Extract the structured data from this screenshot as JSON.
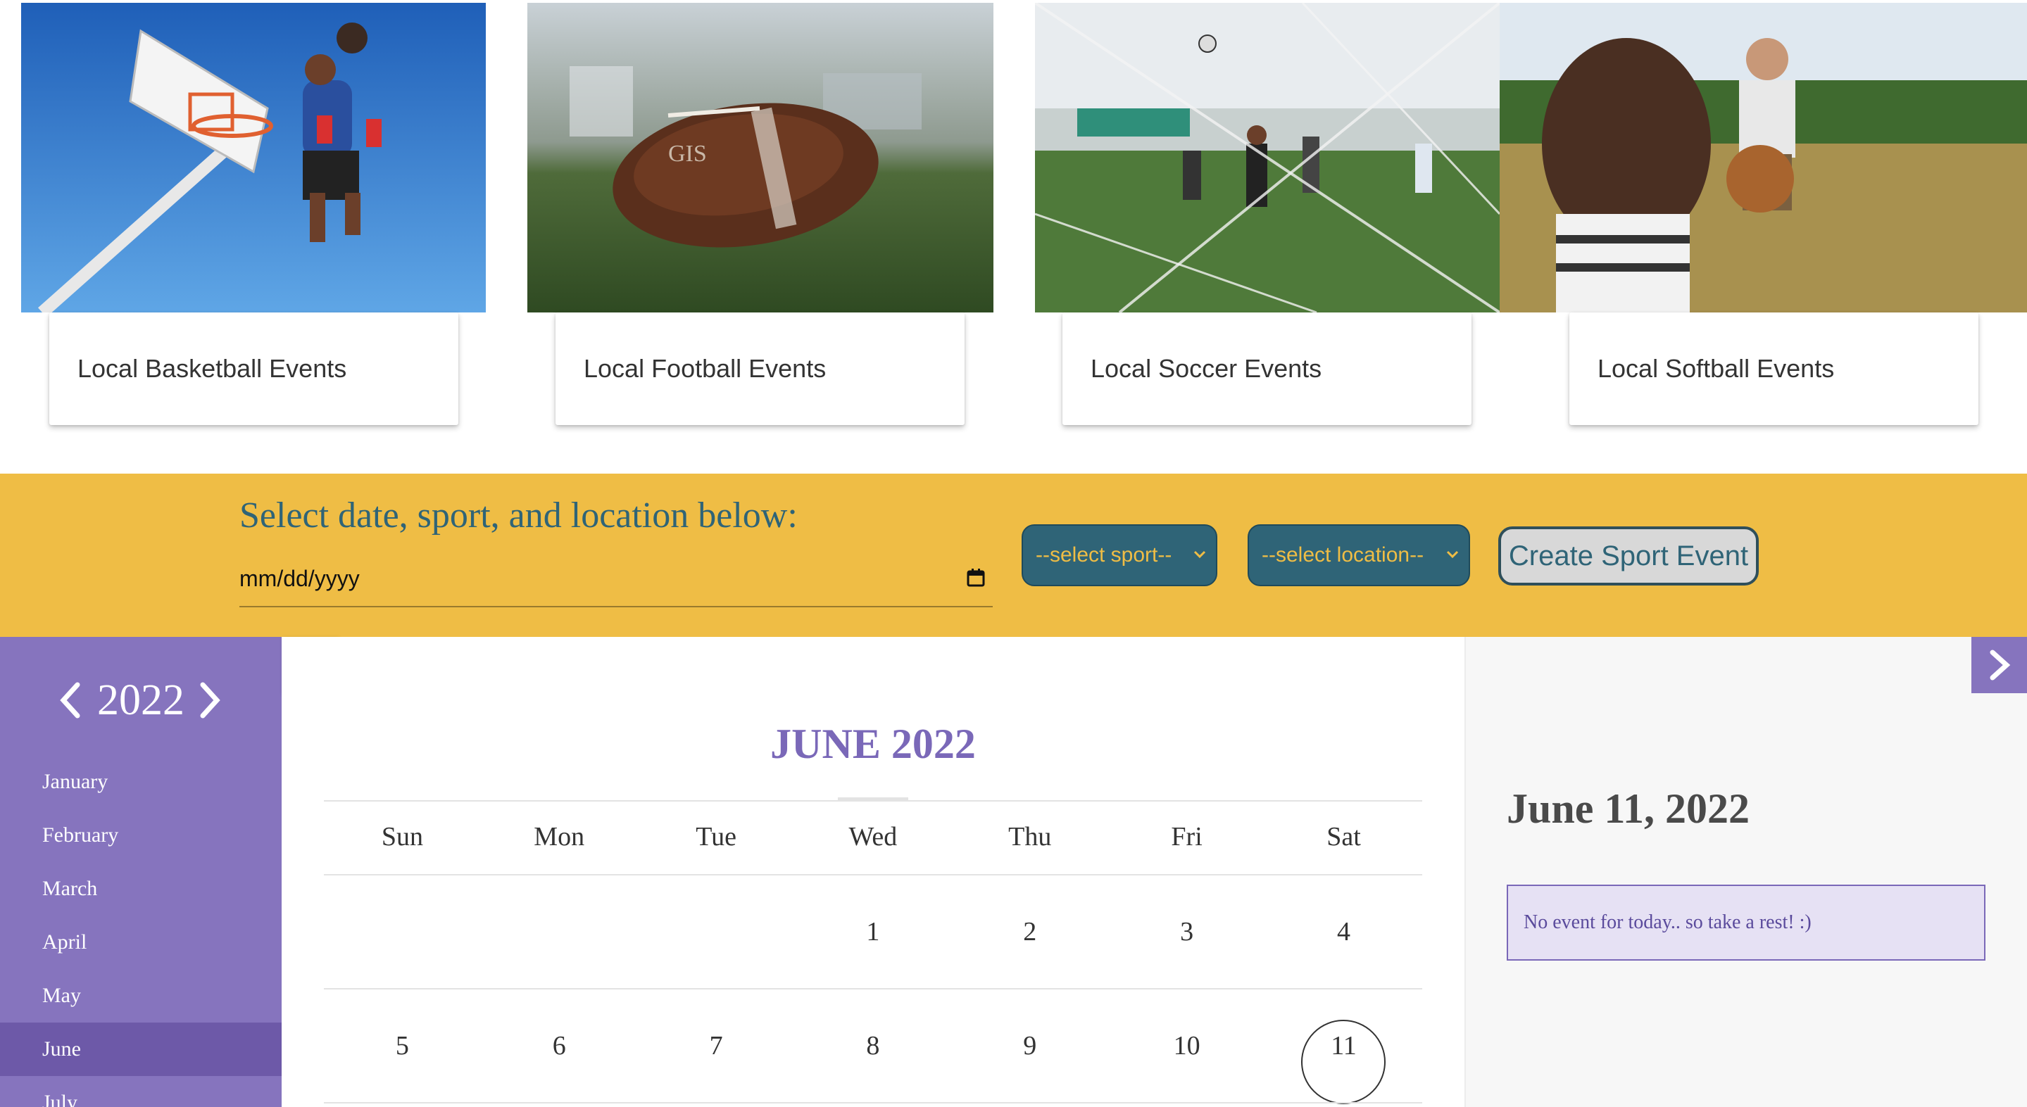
{
  "sports": [
    {
      "label": "Local Basketball Events",
      "image": "basketball-dunk"
    },
    {
      "label": "Local Football Events",
      "image": "football-on-grass"
    },
    {
      "label": "Local Soccer Events",
      "image": "soccer-players"
    },
    {
      "label": "Local Softball Events",
      "image": "softball-catch"
    }
  ],
  "form": {
    "title": "Select date, sport, and location below:",
    "date_placeholder": "mm/dd/yyyy",
    "sport_select": "--select sport--",
    "location_select": "--select location--",
    "create_button": "Create Sport Event"
  },
  "calendar": {
    "year": "2022",
    "months": [
      "January",
      "February",
      "March",
      "April",
      "May",
      "June",
      "July"
    ],
    "active_month": "June",
    "month_title": "JUNE 2022",
    "weekdays": [
      "Sun",
      "Mon",
      "Tue",
      "Wed",
      "Thu",
      "Fri",
      "Sat"
    ],
    "week1": [
      "",
      "",
      "",
      "1",
      "2",
      "3",
      "4"
    ],
    "week2": [
      "5",
      "6",
      "7",
      "8",
      "9",
      "10",
      "11"
    ],
    "selected_day": "11"
  },
  "details": {
    "selected_date": "June 11, 2022",
    "message": "No event for today.. so take a rest! :)"
  },
  "colors": {
    "band": "#efbd45",
    "teal": "#2f6477",
    "purple": "#8674be",
    "purple_dark": "#6d59a8"
  }
}
